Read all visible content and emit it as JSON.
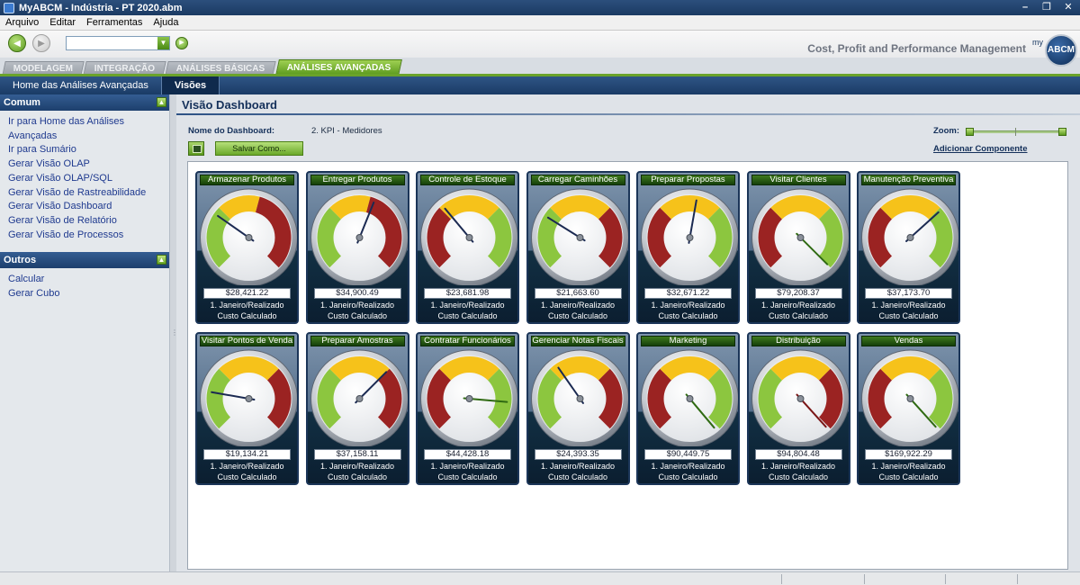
{
  "window": {
    "title": "MyABCM - Indústria - PT 2020.abm"
  },
  "menu": [
    "Arquivo",
    "Editar",
    "Ferramentas",
    "Ajuda"
  ],
  "tagline": "Cost, Profit and Performance Management",
  "logo": {
    "prefix": "my",
    "text": "ABCM"
  },
  "module_tabs": [
    {
      "label": "MODELAGEM",
      "active": false
    },
    {
      "label": "INTEGRAÇÃO",
      "active": false
    },
    {
      "label": "ANÁLISES BÁSICAS",
      "active": false
    },
    {
      "label": "ANÁLISES AVANÇADAS",
      "active": true
    }
  ],
  "subnav": [
    {
      "label": "Home das Análises Avançadas",
      "active": false
    },
    {
      "label": "Visões",
      "active": true
    }
  ],
  "sidebar": {
    "sections": [
      {
        "title": "Comum",
        "items": [
          "Ir para Home das Análises Avançadas",
          "Ir para Sumário",
          "Gerar Visão OLAP",
          "Gerar Visão OLAP/SQL",
          "Gerar Visão de Rastreabilidade",
          "Gerar Visão Dashboard",
          "Gerar Visão de Relatório",
          "Gerar Visão de Processos"
        ]
      },
      {
        "title": "Outros",
        "items": [
          "Calcular",
          "Gerar Cubo"
        ]
      }
    ]
  },
  "main": {
    "title": "Visão Dashboard",
    "dashboard_label": "Nome do Dashboard:",
    "dashboard_name": "2. KPI - Medidores",
    "zoom_label": "Zoom:",
    "add_component": "Adicionar Componente",
    "save_as": "Salvar Como...",
    "zoom_value": 1.0
  },
  "gauges": [
    {
      "title": "Armazenar Produtos",
      "value": "$28,421.22",
      "period": "1. Janeiro/Realizado",
      "measure": "Custo Calculado",
      "scheme": "grr",
      "needle": -55
    },
    {
      "title": "Entregar Produtos",
      "value": "$34,900.49",
      "period": "1. Janeiro/Realizado",
      "measure": "Custo Calculado",
      "scheme": "grr",
      "needle": 22
    },
    {
      "title": "Controle de Estoque",
      "value": "$23,681.98",
      "period": "1. Janeiro/Realizado",
      "measure": "Custo Calculado",
      "scheme": "rg",
      "needle": -40
    },
    {
      "title": "Carregar Caminhões",
      "value": "$21,663.60",
      "period": "1. Janeiro/Realizado",
      "measure": "Custo Calculado",
      "scheme": "gr",
      "needle": -58
    },
    {
      "title": "Preparar Propostas",
      "value": "$32,671.22",
      "period": "1. Janeiro/Realizado",
      "measure": "Custo Calculado",
      "scheme": "rg",
      "needle": 10
    },
    {
      "title": "Visitar Clientes",
      "value": "$79,208.37",
      "period": "1. Janeiro/Realizado",
      "measure": "Custo Calculado",
      "scheme": "rg",
      "needle": 135
    },
    {
      "title": "Manutenção Preventiva",
      "value": "$37,173.70",
      "period": "1. Janeiro/Realizado",
      "measure": "Custo Calculado",
      "scheme": "rg",
      "needle": 48
    },
    {
      "title": "Visitar Pontos de Venda",
      "value": "$19,134.21",
      "period": "1. Janeiro/Realizado",
      "measure": "Custo Calculado",
      "scheme": "gr",
      "needle": -80
    },
    {
      "title": "Preparar Amostras",
      "value": "$37,158.11",
      "period": "1. Janeiro/Realizado",
      "measure": "Custo Calculado",
      "scheme": "gr",
      "needle": 45
    },
    {
      "title": "Contratar Funcionários",
      "value": "$44,428.18",
      "period": "1. Janeiro/Realizado",
      "measure": "Custo Calculado",
      "scheme": "rg",
      "needle": 95
    },
    {
      "title": "Gerenciar Notas Fiscais",
      "value": "$24,393.35",
      "period": "1. Janeiro/Realizado",
      "measure": "Custo Calculado",
      "scheme": "gr",
      "needle": -35
    },
    {
      "title": "Marketing",
      "value": "$90,449.75",
      "period": "1. Janeiro/Realizado",
      "measure": "Custo Calculado",
      "scheme": "rg",
      "needle": 140
    },
    {
      "title": "Distribuição",
      "value": "$94,804.48",
      "period": "1. Janeiro/Realizado",
      "measure": "Custo Calculado",
      "scheme": "gr",
      "needle": 138
    },
    {
      "title": "Vendas",
      "value": "$169,922.29",
      "period": "1. Janeiro/Realizado",
      "measure": "Custo Calculado",
      "scheme": "rg",
      "needle": 138
    }
  ],
  "colors": {
    "green": "#8cc63f",
    "yellow": "#f6c21a",
    "red": "#9b2322",
    "navy": "#1b3a63"
  }
}
